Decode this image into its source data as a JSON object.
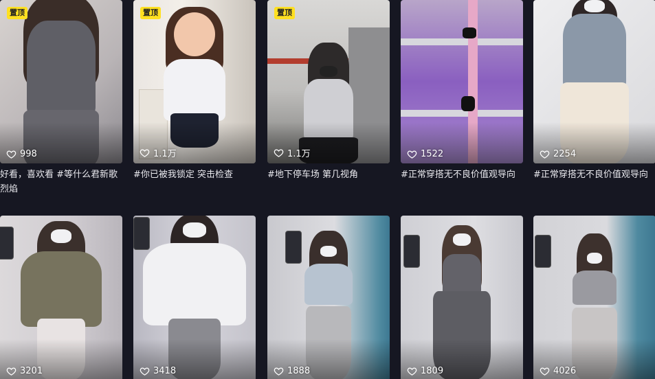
{
  "pinned_badge": "置顶",
  "videos": [
    {
      "likes": "998",
      "caption": "好看，喜欢看 #等什么君新歌 烈焰",
      "pinned": true
    },
    {
      "likes": "1.1万",
      "caption": "#你已被我锁定 突击检查",
      "pinned": true
    },
    {
      "likes": "1.1万",
      "caption": "#地下停车场 第几视角",
      "pinned": true
    },
    {
      "likes": "1522",
      "caption": "#正常穿搭无不良价值观导向",
      "pinned": false
    },
    {
      "likes": "2254",
      "caption": "#正常穿搭无不良价值观导向",
      "pinned": false
    },
    {
      "likes": "3201",
      "caption": "",
      "pinned": false
    },
    {
      "likes": "3418",
      "caption": "",
      "pinned": false
    },
    {
      "likes": "1888",
      "caption": "",
      "pinned": false
    },
    {
      "likes": "1809",
      "caption": "",
      "pinned": false
    },
    {
      "likes": "4026",
      "caption": "",
      "pinned": false
    }
  ],
  "colors": {
    "background": "#161722",
    "pin_badge": "#ffe021",
    "text": "#e9e9ee"
  },
  "icons": {
    "like": "heart-outline-icon"
  }
}
